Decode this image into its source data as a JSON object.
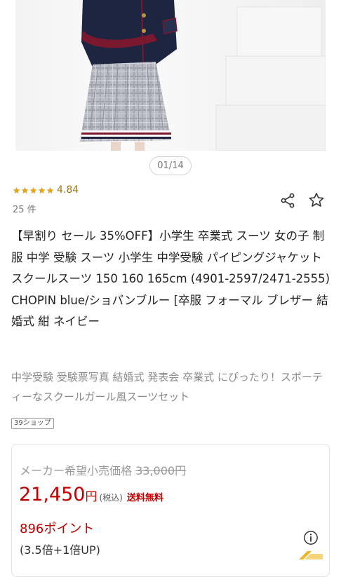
{
  "gallery": {
    "counter": "01/14",
    "image_label": "product-photo-blazer-plaid-skirt"
  },
  "rating": {
    "value": "4.84",
    "stars": 5,
    "count": "25 件",
    "star_color": "#e8a317"
  },
  "actions": {
    "share_icon": "share-icon",
    "favorite_icon": "star-outline-icon"
  },
  "product": {
    "title": "【早割り セール 35%OFF】小学生 卒業式 スーツ 女の子 制服 中学 受験 スーツ 小学生 中学受験 パイピングジャケットスクールスーツ 150 160 165cm (4901-2597/2471-2555) CHOPIN blue/ショパンブルー [卒服 フォーマル ブレザー 結婚式 紺 ネイビー",
    "catch_copy": "中学受験 受験票写真 結婚式 発表会 卒業式 にぴったり！スポーティーなスクールガール風スーツセット",
    "shop_badge": "39ショップ"
  },
  "price": {
    "msrp_label": "メーカー希望小売価格",
    "msrp_value": "33,000円",
    "amount": "21,450",
    "currency": "円",
    "tax_note": "(税込)",
    "shipping": "送料無料",
    "points": "896ポイント",
    "points_detail": "(3.5倍+1倍UP)",
    "accent_color": "#bf0000"
  }
}
